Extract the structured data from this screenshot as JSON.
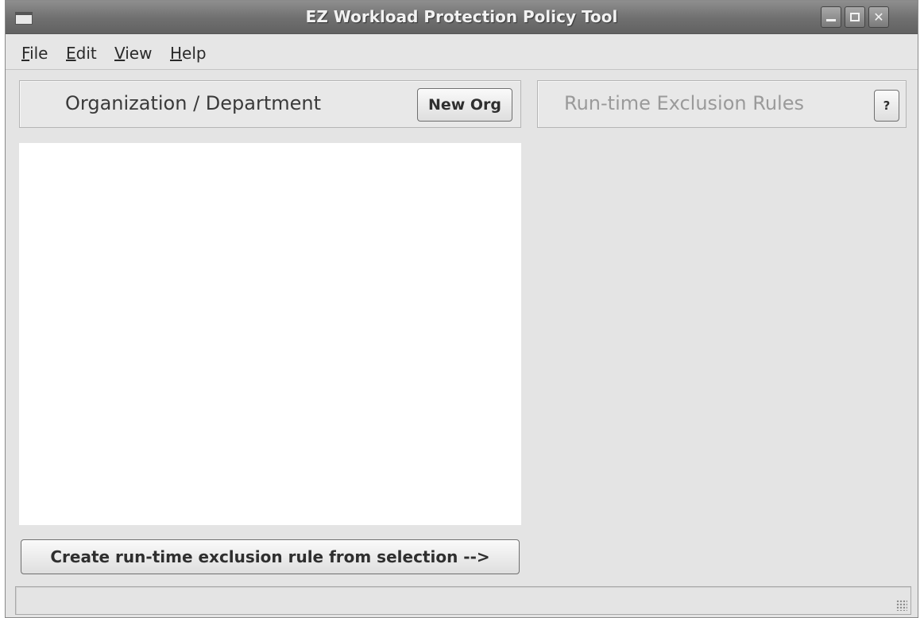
{
  "window": {
    "title": "EZ Workload Protection Policy Tool",
    "controls": {
      "minimize": "minimize-icon",
      "maximize": "maximize-icon",
      "close_glyph": "✕"
    }
  },
  "menubar": {
    "items": [
      {
        "mnemonic": "F",
        "rest": "ile"
      },
      {
        "mnemonic": "E",
        "rest": "dit"
      },
      {
        "mnemonic": "V",
        "rest": "iew"
      },
      {
        "mnemonic": "H",
        "rest": "elp"
      }
    ]
  },
  "left_panel": {
    "title": "Organization / Department",
    "new_org_label": "New Org",
    "create_rule_label": "Create run-time exclusion rule from selection -->"
  },
  "right_panel": {
    "title": "Run-time Exclusion Rules",
    "help_label": "?"
  },
  "colors": {
    "titlebar": "#6f6f6f",
    "window_bg": "#e4e4e4",
    "list_bg": "#ffffff",
    "disabled_text": "#9a9a9a"
  }
}
